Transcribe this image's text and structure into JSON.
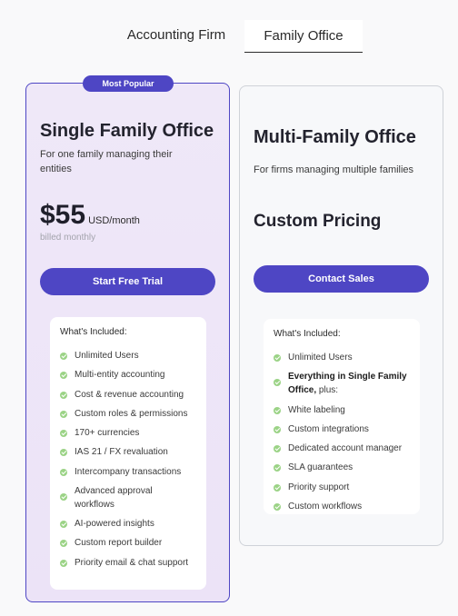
{
  "tabs": {
    "accounting": "Accounting Firm",
    "family": "Family Office"
  },
  "single": {
    "badge": "Most Popular",
    "title": "Single Family Office",
    "desc_line1": "For one family managing their",
    "desc_line2": "entities",
    "price": "$55",
    "price_unit": "USD/month",
    "billing": "billed monthly",
    "cta": "Start Free Trial",
    "included_title": "What's Included:",
    "features": [
      "Unlimited Users",
      "Multi-entity accounting",
      "Cost & revenue accounting",
      "Custom roles & permissions",
      "170+ currencies",
      "IAS 21 / FX revaluation",
      "Intercompany transactions",
      "Advanced approval",
      "workflows",
      "AI-powered insights",
      "Custom report builder",
      "Priority email & chat support"
    ]
  },
  "multi": {
    "title": "Multi-Family Office",
    "desc": "For firms managing multiple families",
    "price": "Custom Pricing",
    "cta": "Contact Sales",
    "included_title": "What's Included:",
    "features": [
      "Unlimited Users",
      "Everything in Single Family",
      "Office,",
      "plus:",
      "White labeling",
      "Custom integrations",
      "Dedicated account manager",
      "SLA guarantees",
      "Priority support",
      "Custom workflows"
    ]
  },
  "colors": {
    "accent": "#4e46c4",
    "check": "#9bd386",
    "highlight_bg": "#efe8f8"
  }
}
